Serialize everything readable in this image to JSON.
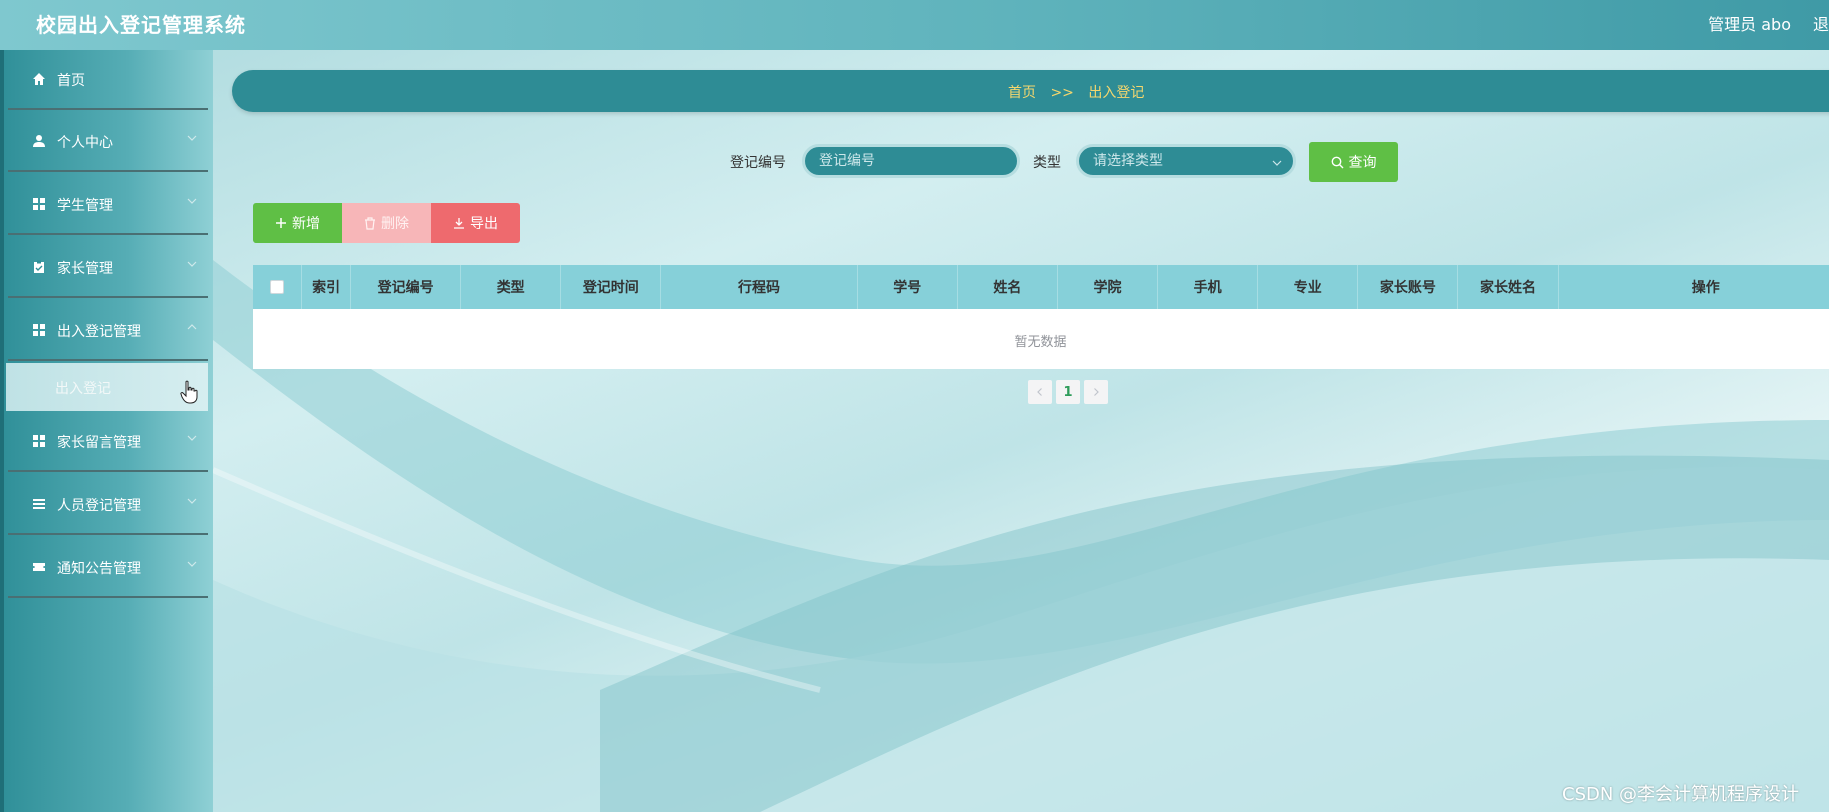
{
  "app": {
    "title": "校园出入登记管理系统"
  },
  "header": {
    "user": "管理员 abo",
    "logout": "退出"
  },
  "sidebar": {
    "items": [
      {
        "label": "首页",
        "icon": "home-icon"
      },
      {
        "label": "个人中心",
        "icon": "user-icon"
      },
      {
        "label": "学生管理",
        "icon": "grid-icon"
      },
      {
        "label": "家长管理",
        "icon": "clipboard-icon"
      },
      {
        "label": "出入登记管理",
        "icon": "grid-icon"
      },
      {
        "label": "家长留言管理",
        "icon": "grid-icon"
      },
      {
        "label": "人员登记管理",
        "icon": "list-icon"
      },
      {
        "label": "通知公告管理",
        "icon": "ticket-icon"
      }
    ],
    "submenu": {
      "label": "出入登记"
    }
  },
  "breadcrumb": {
    "home": "首页",
    "separator": ">>",
    "current": "出入登记"
  },
  "search": {
    "reg_no_label": "登记编号",
    "reg_no_placeholder": "登记编号",
    "type_label": "类型",
    "type_placeholder": "请选择类型",
    "query_label": "查询"
  },
  "actions": {
    "add": "新增",
    "delete": "删除",
    "export": "导出"
  },
  "table": {
    "columns": [
      "索引",
      "登记编号",
      "类型",
      "登记时间",
      "行程码",
      "学号",
      "姓名",
      "学院",
      "手机",
      "专业",
      "家长账号",
      "家长姓名",
      "操作"
    ],
    "empty_text": "暂无数据"
  },
  "pagination": {
    "current_page": "1"
  },
  "watermark": "CSDN @李会计算机程序设计",
  "colors": {
    "accent": "#2e8c95",
    "breadcrumb_text": "#f5d76e",
    "success": "#5fbf45",
    "danger": "#ee6a6e",
    "danger_light": "#f7b6b8",
    "table_header": "#86d0d9"
  }
}
